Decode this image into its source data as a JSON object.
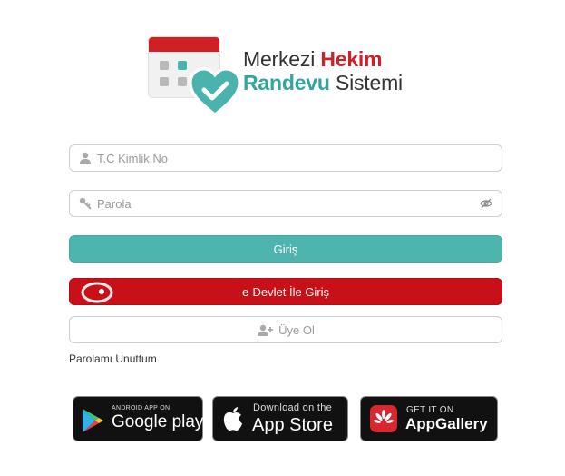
{
  "logo": {
    "brand_line1_prefix": "Merkezi",
    "brand_line1_emph": "Hekim",
    "brand_line2_emph": "Randevu",
    "brand_line2_suffix": "Sistemi"
  },
  "form": {
    "tc_placeholder": "T.C Kimlik No",
    "tc_value": "",
    "password_placeholder": "Parola",
    "password_value": "",
    "login_label": "Giriş",
    "edevlet_label": "e-Devlet İle Giriş",
    "register_label": "Üye Ol",
    "forgot_label": "Parolamı Unuttum"
  },
  "stores": {
    "google": {
      "small": "ANDROID APP ON",
      "big_a": "Google",
      "big_b": "play",
      "icon": "google-play-icon"
    },
    "apple": {
      "small": "Download on the",
      "big": "App Store",
      "icon": "apple-icon"
    },
    "huawei": {
      "small": "GET IT ON",
      "big": "AppGallery",
      "icon": "huawei-icon"
    }
  },
  "colors": {
    "brand_red": "#d11f26",
    "brand_teal": "#2fa7a0",
    "login_button": "#4db5ad",
    "edevlet_button": "#c71018"
  }
}
